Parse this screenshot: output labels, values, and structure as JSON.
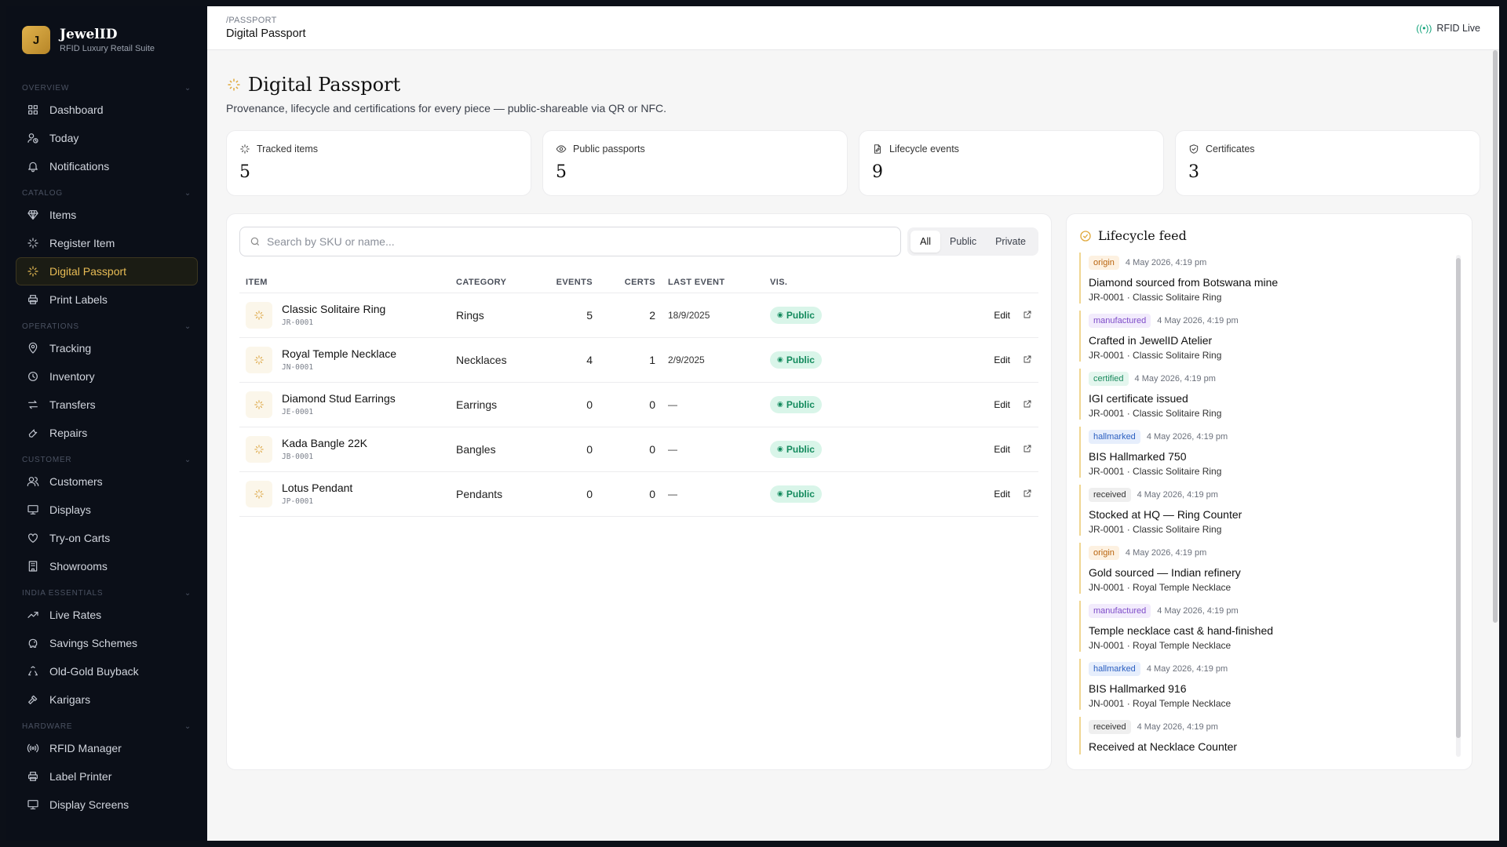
{
  "brand": {
    "logo_letter": "J",
    "name": "JewelID",
    "subtitle": "RFID Luxury Retail Suite"
  },
  "sidebar": {
    "sections": [
      {
        "heading": "OVERVIEW",
        "items": [
          {
            "label": "Dashboard",
            "icon": "grid-icon"
          },
          {
            "label": "Today",
            "icon": "user-clock-icon"
          },
          {
            "label": "Notifications",
            "icon": "bell-icon"
          }
        ]
      },
      {
        "heading": "CATALOG",
        "items": [
          {
            "label": "Items",
            "icon": "gem-icon"
          },
          {
            "label": "Register Item",
            "icon": "sparkle-icon"
          },
          {
            "label": "Digital Passport",
            "icon": "sparkle-icon",
            "active": true
          },
          {
            "label": "Print Labels",
            "icon": "printer-icon"
          }
        ]
      },
      {
        "heading": "OPERATIONS",
        "items": [
          {
            "label": "Tracking",
            "icon": "map-pin-icon"
          },
          {
            "label": "Inventory",
            "icon": "clock-icon"
          },
          {
            "label": "Transfers",
            "icon": "transfer-icon"
          },
          {
            "label": "Repairs",
            "icon": "wrench-icon"
          }
        ]
      },
      {
        "heading": "CUSTOMER",
        "items": [
          {
            "label": "Customers",
            "icon": "users-icon"
          },
          {
            "label": "Displays",
            "icon": "monitor-icon"
          },
          {
            "label": "Try-on Carts",
            "icon": "heart-icon"
          },
          {
            "label": "Showrooms",
            "icon": "building-icon"
          }
        ]
      },
      {
        "heading": "INDIA ESSENTIALS",
        "items": [
          {
            "label": "Live Rates",
            "icon": "trend-icon"
          },
          {
            "label": "Savings Schemes",
            "icon": "piggy-icon"
          },
          {
            "label": "Old-Gold Buyback",
            "icon": "recycle-icon"
          },
          {
            "label": "Karigars",
            "icon": "hammer-icon"
          }
        ]
      },
      {
        "heading": "HARDWARE",
        "items": [
          {
            "label": "RFID Manager",
            "icon": "radio-icon"
          },
          {
            "label": "Label Printer",
            "icon": "printer-icon"
          },
          {
            "label": "Display Screens",
            "icon": "monitor-icon"
          }
        ]
      }
    ]
  },
  "topbar": {
    "breadcrumb": "/PASSPORT",
    "title": "Digital Passport",
    "status": "RFID Live"
  },
  "page": {
    "title": "Digital Passport",
    "description": "Provenance, lifecycle and certifications for every piece — public-shareable via QR or NFC."
  },
  "stats": [
    {
      "label": "Tracked items",
      "value": "5",
      "icon": "sparkle-icon"
    },
    {
      "label": "Public passports",
      "value": "5",
      "icon": "eye-icon"
    },
    {
      "label": "Lifecycle events",
      "value": "9",
      "icon": "file-edit-icon"
    },
    {
      "label": "Certificates",
      "value": "3",
      "icon": "shield-check-icon"
    }
  ],
  "search": {
    "placeholder": "Search by SKU or name...",
    "value": ""
  },
  "filters": {
    "all": "All",
    "public": "Public",
    "private": "Private",
    "selected": "All"
  },
  "table": {
    "headers": {
      "item": "ITEM",
      "category": "CATEGORY",
      "events": "EVENTS",
      "certs": "CERTS",
      "last_event": "LAST EVENT",
      "vis": "VIS."
    },
    "edit_label": "Edit",
    "rows": [
      {
        "name": "Classic Solitaire Ring",
        "sku": "JR-0001",
        "category": "Rings",
        "events": "5",
        "certs": "2",
        "last_event": "18/9/2025",
        "vis": "Public"
      },
      {
        "name": "Royal Temple Necklace",
        "sku": "JN-0001",
        "category": "Necklaces",
        "events": "4",
        "certs": "1",
        "last_event": "2/9/2025",
        "vis": "Public"
      },
      {
        "name": "Diamond Stud Earrings",
        "sku": "JE-0001",
        "category": "Earrings",
        "events": "0",
        "certs": "0",
        "last_event": "—",
        "vis": "Public"
      },
      {
        "name": "Kada Bangle 22K",
        "sku": "JB-0001",
        "category": "Bangles",
        "events": "0",
        "certs": "0",
        "last_event": "—",
        "vis": "Public"
      },
      {
        "name": "Lotus Pendant",
        "sku": "JP-0001",
        "category": "Pendants",
        "events": "0",
        "certs": "0",
        "last_event": "—",
        "vis": "Public"
      }
    ]
  },
  "feed": {
    "title": "Lifecycle feed",
    "items": [
      {
        "tag": "origin",
        "time": "4 May 2026, 4:19 pm",
        "title": "Diamond sourced from Botswana mine",
        "sub": "JR-0001 · Classic Solitaire Ring"
      },
      {
        "tag": "manufactured",
        "time": "4 May 2026, 4:19 pm",
        "title": "Crafted in JewelID Atelier",
        "sub": "JR-0001 · Classic Solitaire Ring"
      },
      {
        "tag": "certified",
        "time": "4 May 2026, 4:19 pm",
        "title": "IGI certificate issued",
        "sub": "JR-0001 · Classic Solitaire Ring"
      },
      {
        "tag": "hallmarked",
        "time": "4 May 2026, 4:19 pm",
        "title": "BIS Hallmarked 750",
        "sub": "JR-0001 · Classic Solitaire Ring"
      },
      {
        "tag": "received",
        "time": "4 May 2026, 4:19 pm",
        "title": "Stocked at HQ — Ring Counter",
        "sub": "JR-0001 · Classic Solitaire Ring"
      },
      {
        "tag": "origin",
        "time": "4 May 2026, 4:19 pm",
        "title": "Gold sourced — Indian refinery",
        "sub": "JN-0001 · Royal Temple Necklace"
      },
      {
        "tag": "manufactured",
        "time": "4 May 2026, 4:19 pm",
        "title": "Temple necklace cast & hand-finished",
        "sub": "JN-0001 · Royal Temple Necklace"
      },
      {
        "tag": "hallmarked",
        "time": "4 May 2026, 4:19 pm",
        "title": "BIS Hallmarked 916",
        "sub": "JN-0001 · Royal Temple Necklace"
      },
      {
        "tag": "received",
        "time": "4 May 2026, 4:19 pm",
        "title": "Received at Necklace Counter",
        "sub": ""
      }
    ]
  },
  "colors": {
    "accent": "#e0a83b",
    "sidebar_bg": "#0b0f18",
    "public_badge": "#d9f5e9",
    "live": "#12a37a"
  }
}
